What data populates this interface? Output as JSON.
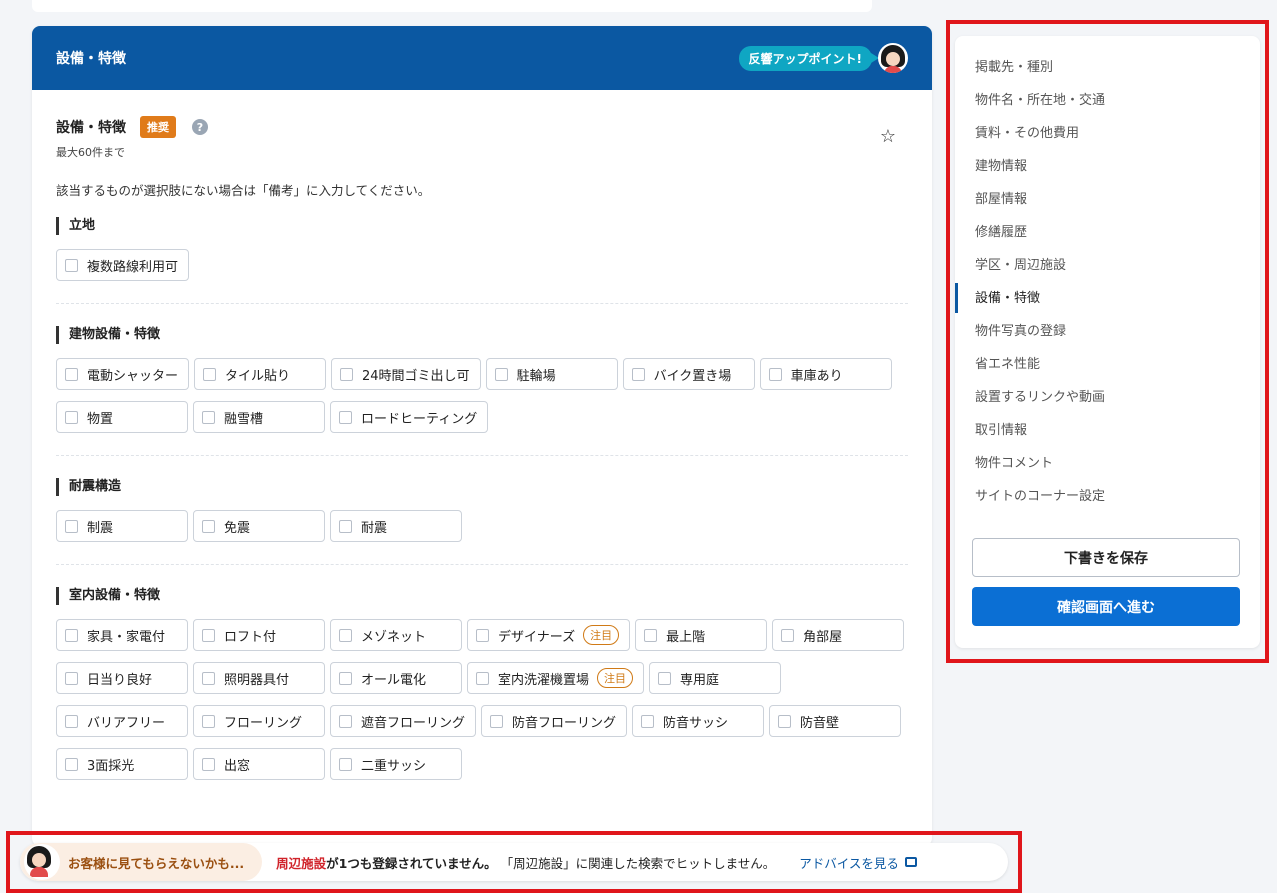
{
  "card": {
    "title": "設備・特徴",
    "badge": "反響アップポイント!"
  },
  "field": {
    "title": "設備・特徴",
    "recommended": "推奨",
    "help": "?",
    "limit": "最大60件まで",
    "note": "該当するものが選択肢にない場合は「備考」に入力してください。"
  },
  "sections": [
    {
      "title": "立地",
      "options": [
        {
          "label": "複数路線利用可"
        }
      ]
    },
    {
      "title": "建物設備・特徴",
      "options": [
        {
          "label": "電動シャッター"
        },
        {
          "label": "タイル貼り"
        },
        {
          "label": "24時間ゴミ出し可"
        },
        {
          "label": "駐輪場"
        },
        {
          "label": "バイク置き場"
        },
        {
          "label": "車庫あり"
        },
        {
          "label": "物置"
        },
        {
          "label": "融雪槽"
        },
        {
          "label": "ロードヒーティング"
        }
      ]
    },
    {
      "title": "耐震構造",
      "options": [
        {
          "label": "制震"
        },
        {
          "label": "免震"
        },
        {
          "label": "耐震"
        }
      ]
    },
    {
      "title": "室内設備・特徴",
      "options": [
        {
          "label": "家具・家電付"
        },
        {
          "label": "ロフト付"
        },
        {
          "label": "メゾネット"
        },
        {
          "label": "デザイナーズ",
          "tag": "注目"
        },
        {
          "label": "最上階"
        },
        {
          "label": "角部屋"
        },
        {
          "label": "日当り良好"
        },
        {
          "label": "照明器具付"
        },
        {
          "label": "オール電化"
        },
        {
          "label": "室内洗濯機置場",
          "tag": "注目"
        },
        {
          "label": "専用庭"
        },
        {
          "label": "バリアフリー"
        },
        {
          "label": "フローリング"
        },
        {
          "label": "遮音フローリング"
        },
        {
          "label": "防音フローリング"
        },
        {
          "label": "防音サッシ"
        },
        {
          "label": "防音壁"
        },
        {
          "label": "3面採光"
        },
        {
          "label": "出窓"
        },
        {
          "label": "二重サッシ"
        }
      ]
    }
  ],
  "sidebar": {
    "items": [
      {
        "label": "掲載先・種別"
      },
      {
        "label": "物件名・所在地・交通"
      },
      {
        "label": "賃料・その他費用"
      },
      {
        "label": "建物情報"
      },
      {
        "label": "部屋情報"
      },
      {
        "label": "修繕履歴"
      },
      {
        "label": "学区・周辺施設"
      },
      {
        "label": "設備・特徴",
        "active": true
      },
      {
        "label": "物件写真の登録"
      },
      {
        "label": "省エネ性能"
      },
      {
        "label": "設置するリンクや動画"
      },
      {
        "label": "取引情報"
      },
      {
        "label": "物件コメント"
      },
      {
        "label": "サイトのコーナー設定"
      }
    ],
    "save_draft": "下書きを保存",
    "confirm": "確認画面へ進む"
  },
  "bottom": {
    "warning": "お客様に見てもらえないかも...",
    "link": "周辺施設",
    "msg_strong": "が1つも登録されていません。",
    "msg_rest": "「周辺施設」に関連した検索でヒットしません。",
    "advice": "アドバイスを見る"
  },
  "colors": {
    "header_blue": "#0b58a2",
    "primary_button": "#0b6fd4",
    "recommended_badge": "#e07b1a",
    "attention_tag": "#d07a16",
    "highlight_border": "#e0161b"
  }
}
